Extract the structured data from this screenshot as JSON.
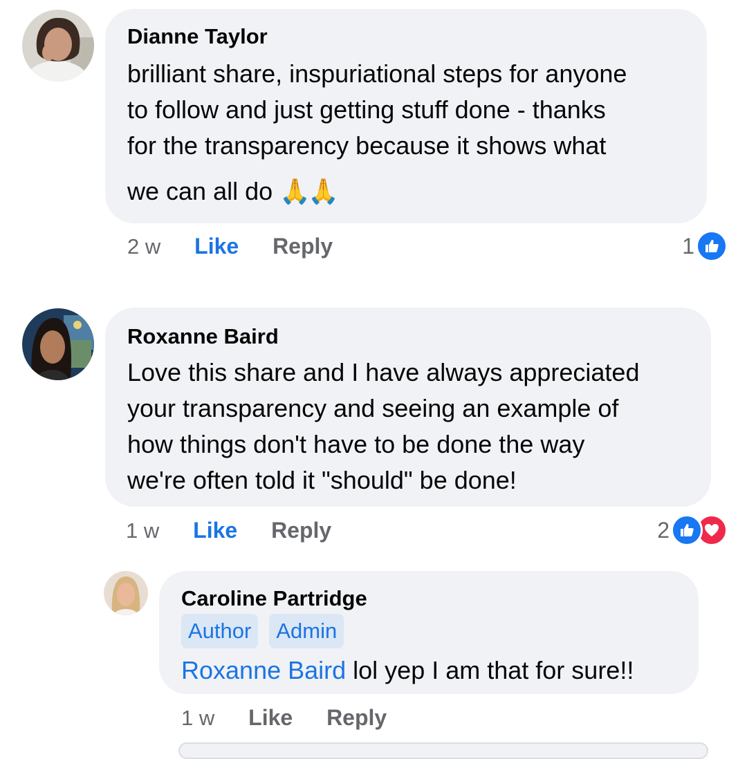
{
  "comments": [
    {
      "author": "Dianne Taylor",
      "lines": [
        "brilliant share, inspuriational steps for anyone",
        "to follow and just getting stuff done - thanks",
        "for the transparency because it shows what",
        "we can all do"
      ],
      "emoji": "🙏🙏",
      "time": "2 w",
      "like_label": "Like",
      "reply_label": "Reply",
      "reaction_count": "1",
      "reactions": [
        "like-icon"
      ]
    },
    {
      "author": "Roxanne Baird",
      "lines": [
        "Love this share and I have always appreciated",
        "your transparency and seeing an example of",
        "how things don't have to be done the way",
        "we're often told it \"should\" be done!"
      ],
      "time": "1 w",
      "like_label": "Like",
      "reply_label": "Reply",
      "reaction_count": "2",
      "reactions": [
        "like-icon",
        "love-icon"
      ]
    }
  ],
  "reply": {
    "author": "Caroline Partridge",
    "badges": [
      "Author",
      "Admin"
    ],
    "mention": "Roxanne Baird",
    "text": " lol yep I am that for sure!!",
    "time": "1 w",
    "like_label": "Like",
    "reply_label": "Reply"
  },
  "colors": {
    "bubble": "#f0f2f5",
    "link_blue": "#1b74e4",
    "meta_gray": "#65676b",
    "like_blue": "#1877f2",
    "love_red": "#f02849"
  }
}
